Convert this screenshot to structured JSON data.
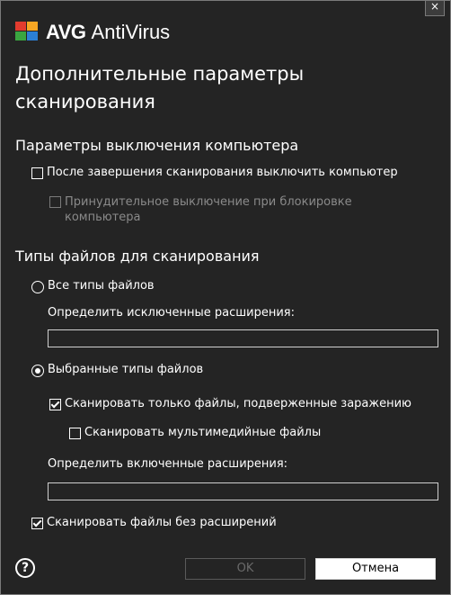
{
  "window": {
    "close_glyph": "×"
  },
  "brand": {
    "logo_text": "AVG",
    "product": "AntiVirus"
  },
  "title": {
    "line1": "Дополнительные параметры",
    "line2": "сканирования"
  },
  "shutdown": {
    "heading": "Параметры выключения компьютера",
    "shutdown_after_scan": {
      "label": "После завершения сканирования выключить компьютер",
      "checked": false
    },
    "force_shutdown": {
      "label_line1": "Принудительное выключение при блокировке",
      "label_line2": "компьютера",
      "checked": false,
      "enabled": false
    }
  },
  "filetypes": {
    "heading": "Типы файлов для сканирования",
    "all_types": {
      "label": "Все типы файлов",
      "selected": false
    },
    "exclude_label": "Определить исключенные расширения:",
    "exclude_value": "",
    "selected_types": {
      "label": "Выбранные типы файлов",
      "selected": true
    },
    "infectable_only": {
      "label": "Сканировать только файлы, подверженные заражению",
      "checked": true
    },
    "multimedia": {
      "label": "Сканировать мультимедийные файлы",
      "checked": false
    },
    "include_label": "Определить включенные расширения:",
    "include_value": "",
    "no_extension": {
      "label": "Сканировать файлы без расширений",
      "checked": true
    }
  },
  "footer": {
    "help_glyph": "?",
    "ok_label": "OK",
    "cancel_label": "Отмена"
  },
  "colors": {
    "background": "#242424",
    "disabled_text": "#8a8a8a",
    "cancel_bg": "#ffffff"
  }
}
